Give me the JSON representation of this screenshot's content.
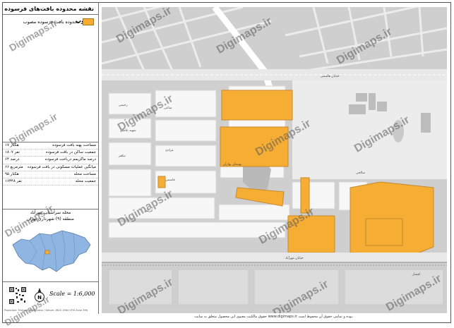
{
  "sidebar": {
    "title": "نقشه محدوده بافت‌های فرسوده مصوب",
    "legend_label": "محدوده بافت فرسوده مصوب",
    "stats": [
      {
        "label": "مساحت پهنه بافت فرسوده",
        "value": "۱۷ هکتار"
      },
      {
        "label": "جمعیت ساکن در بافت فرسوده",
        "value": "۱۸۰۷ نفر"
      },
      {
        "label": "درصد ماکزیمم درباخت فرسوده",
        "value": "۶۴ درصد"
      },
      {
        "label": "میانگین عملیات مسکونی در بافت فرسوده",
        "value": "۶۶ مترمربع"
      },
      {
        "label": "مساحت محله",
        "value": "۹۵ هکتار"
      },
      {
        "label": "جمعیت محله",
        "value": "۱۶۳۴۸ نفر"
      }
    ],
    "region_line1": "محله سرآسیاب مهرآباد",
    "region_line2": "منطقه (۹) شهرداری تهران",
    "scale": "Scale = 1:6,000",
    "small_print": "Projection: Transverse Mercator / Datum: WGS 1984 UTM Zone 39N"
  },
  "watermark": "Digimaps.ir",
  "footer": "حقوق مالکیت معنوی این محصول متعلق به سایت www.digimaps.ir بوده و تمامی حقوق آن محفوظ است.",
  "map_labels": {
    "road_top": "خیابان هاشمی",
    "road_bottom": "خیابان مهرآباد",
    "street_a": "رحیمی",
    "street_b": "ساعی",
    "street_c": "مرادی",
    "street_d": "شهید عاملی",
    "street_e": "نیکفر",
    "street_f": "قاسمی",
    "street_g": "کریمی",
    "street_h": "بوستان بهاران",
    "street_i": "صالحی",
    "street_j": "افشار"
  },
  "colors": {
    "blocks": "#f5ad34",
    "block_stroke": "#c8892a",
    "streets": "#ffffff",
    "background": "#cfcfcf",
    "inset_fill": "#8fb6e3",
    "inset_highlight": "#f5ad34"
  }
}
